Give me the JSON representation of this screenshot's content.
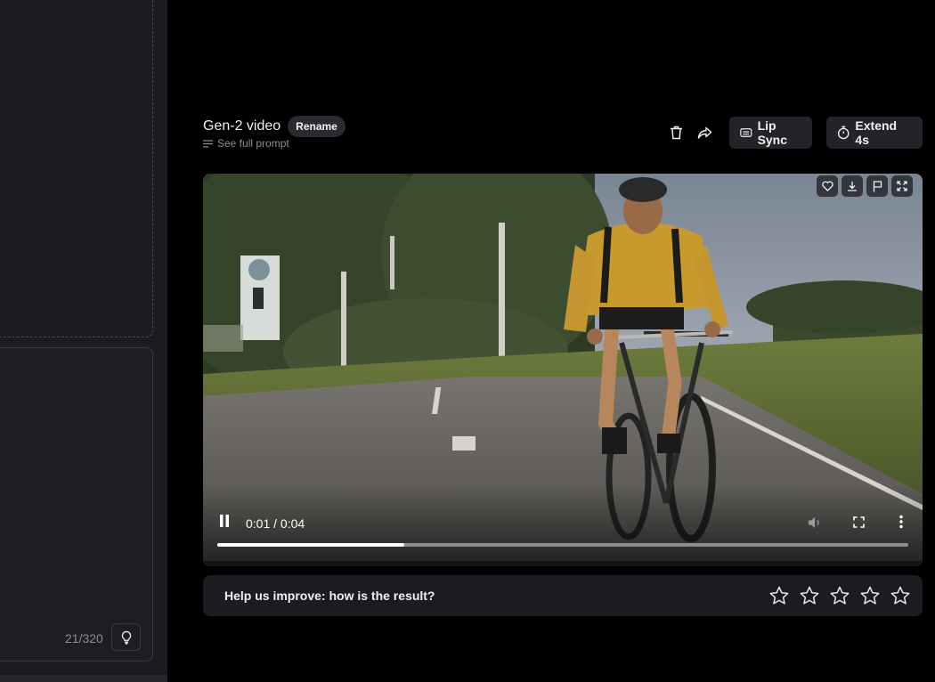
{
  "left_panel": {
    "char_count": "21/320",
    "tip_icon": "lightbulb-icon"
  },
  "header": {
    "title": "Gen-2 video",
    "rename_label": "Rename",
    "see_prompt_label": "See full prompt",
    "lip_sync_label": "Lip Sync",
    "extend_label": "Extend 4s"
  },
  "player": {
    "current_time": "0:01",
    "separator": " / ",
    "duration": "0:04",
    "progress": 0.27,
    "top_icons": [
      "heart-icon",
      "download-icon",
      "flag-icon",
      "expand-icon"
    ]
  },
  "feedback": {
    "prompt": "Help us improve: how is the result?",
    "star_count": 5
  },
  "colors": {
    "background": "#000000",
    "panel": "#1b1c21",
    "button": "#232429",
    "text": "#f0f0f2",
    "muted_text": "#8d8f99"
  }
}
